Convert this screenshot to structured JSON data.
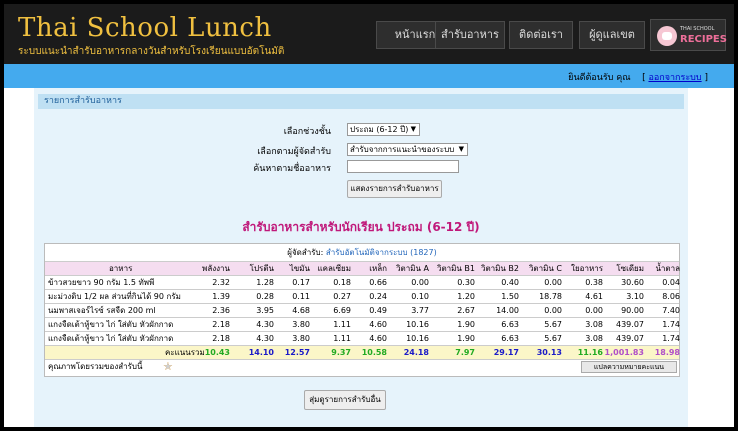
{
  "header": {
    "title": "Thai School Lunch",
    "subtitle": "ระบบแนะนำสำรับอาหารกลางวันสำหรับโรงเรียนแบบอัตโนมัติ",
    "nav": [
      "หน้าแรก",
      "สำรับอาหาร",
      "ติดต่อเรา",
      "ผู้ดูแลเขต"
    ],
    "brand_line1": "THAI SCHOOL",
    "brand_line2": "RECIPES"
  },
  "topbar": {
    "welcome": "ยินดีต้อนรับ คุณ",
    "logout": "ออกจากระบบ",
    "bracket_open": "[",
    "bracket_close": "]"
  },
  "panel": {
    "title": "รายการสำรับอาหาร",
    "level_label": "เลือกช่วงชั้น",
    "level_value": "ประถม (6-12 ปี)",
    "arranger_label": "เลือกตามผู้จัดสำรับ",
    "arranger_value": "สำรับจากการแนะนำของระบบ",
    "search_label": "ค้นหาตามชื่ออาหาร",
    "search_value": "",
    "show_button": "แสดงรายการสำรับอาหาร",
    "menu_title": "สำรับอาหารสำหรับนักเรียน ประถม (6-12 ปี)",
    "random_button": "สุ่มดูรายการสำรับอื่น"
  },
  "table": {
    "arranger_label": "ผู้จัดสำรับ:",
    "arranger_link": "สำรับอัตโนมัติจากระบบ (1827)",
    "headers": [
      "อาหาร",
      "พลังงาน",
      "โปรตีน",
      "ไขมัน",
      "แคลเซียม",
      "เหล็ก",
      "วิตามิน A",
      "วิตามิน B1",
      "วิตามิน B2",
      "วิตามิน C",
      "ใยอาหาร",
      "โซเดียม",
      "น้ำตาล"
    ],
    "rows": [
      [
        "ข้าวสวยขาว 90 กรัม 1.5 ทัพพี",
        "2.32",
        "1.28",
        "0.17",
        "0.18",
        "0.66",
        "0.00",
        "0.30",
        "0.40",
        "0.00",
        "0.38",
        "30.60",
        "0.04"
      ],
      [
        "มะม่วงดิบ 1/2 ผล ส่วนที่กินได้ 90 กรัม",
        "1.39",
        "0.28",
        "0.11",
        "0.27",
        "0.24",
        "0.10",
        "1.20",
        "1.50",
        "18.78",
        "4.61",
        "3.10",
        "8.06"
      ],
      [
        "นมพาสเจอร์ไรซ์ รสจืด 200 ml",
        "2.36",
        "3.95",
        "4.68",
        "6.69",
        "0.49",
        "3.77",
        "2.67",
        "14.00",
        "0.00",
        "0.00",
        "90.00",
        "7.40"
      ],
      [
        "แกงจืดเต้าหู้ขาว ไก่ ใส่ตับ หัวผักกาด",
        "2.18",
        "4.30",
        "3.80",
        "1.11",
        "4.60",
        "10.16",
        "1.90",
        "6.63",
        "5.67",
        "3.08",
        "439.07",
        "1.74"
      ],
      [
        "แกงจืดเต้าหู้ขาว ไก่ ใส่ตับ หัวผักกาด",
        "2.18",
        "4.30",
        "3.80",
        "1.11",
        "4.60",
        "10.16",
        "1.90",
        "6.63",
        "5.67",
        "3.08",
        "439.07",
        "1.74"
      ]
    ],
    "total_label": "คะแนนรวม",
    "totals": [
      "10.43",
      "14.10",
      "12.57",
      "9.37",
      "10.58",
      "24.18",
      "7.97",
      "29.17",
      "30.13",
      "11.16",
      "1,001.83",
      "18.98"
    ],
    "total_colors": [
      "#22aa22",
      "#1a1ac8",
      "#1a1ac8",
      "#22aa22",
      "#22aa22",
      "#1a1ac8",
      "#22aa22",
      "#1a1ac8",
      "#1a1ac8",
      "#22aa22",
      "#b04fc8",
      "#b04fc8"
    ],
    "quality_label": "คุณภาพโดยรวมของสำรับนี้",
    "rating": 4,
    "rating_max": 5,
    "explain_button": "แปลความหมายคะแนน"
  },
  "colors": {
    "header_bg": "#1b1b1b",
    "accent_gold": "#f0c040",
    "topbar_blue": "#44aaee",
    "title_magenta": "#c0187a"
  }
}
